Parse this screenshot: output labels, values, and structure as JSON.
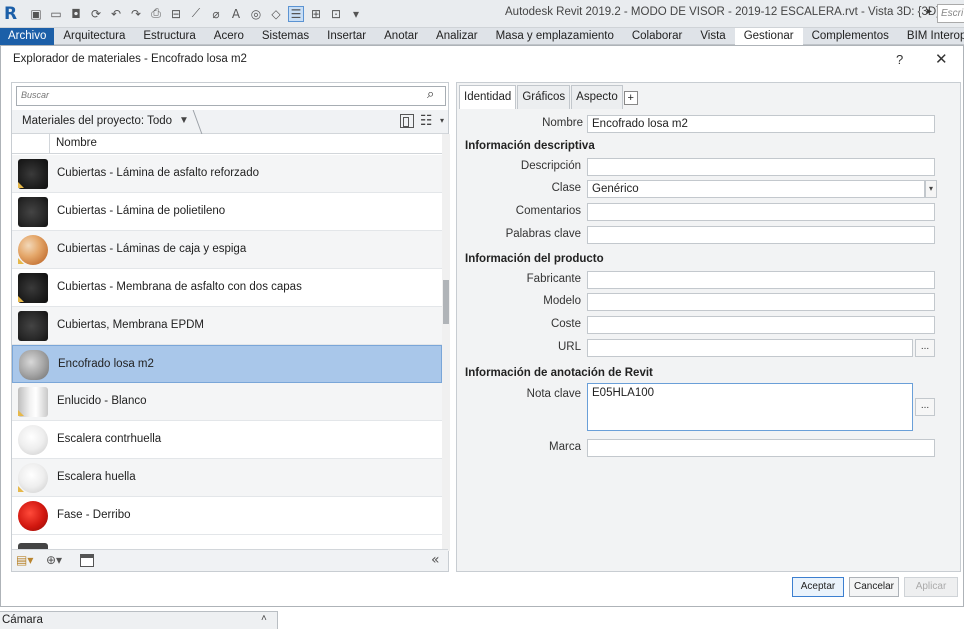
{
  "app_title": "Autodesk Revit 2019.2 - MODO DE VISOR - 2019-12 ESCALERA.rvt - Vista 3D: {3D}",
  "search_top_placeholder": "Escri",
  "ribbon_tabs": [
    "Archivo",
    "Arquitectura",
    "Estructura",
    "Acero",
    "Sistemas",
    "Insertar",
    "Anotar",
    "Analizar",
    "Masa y emplazamiento",
    "Colaborar",
    "Vista",
    "Gestionar",
    "Complementos",
    "BIM Interoperability"
  ],
  "ribbon_current": "Gestionar",
  "dialog": {
    "title": "Explorador de materiales - Encofrado losa m2",
    "help": "?",
    "close": "✕"
  },
  "browser": {
    "search_placeholder": "Buscar",
    "filter_label": "Materiales del proyecto: Todo",
    "column_header": "Nombre",
    "materials": [
      {
        "name": "Cubiertas - Lámina de asfalto reforzado",
        "swatch": "dark"
      },
      {
        "name": "Cubiertas - Lámina de polietileno",
        "swatch": "dark2"
      },
      {
        "name": "Cubiertas - Láminas de caja y espiga",
        "swatch": "wood"
      },
      {
        "name": "Cubiertas - Membrana de asfalto con dos capas",
        "swatch": "dark"
      },
      {
        "name": "Cubiertas, Membrana EPDM",
        "swatch": "dark2"
      },
      {
        "name": "Encofrado losa m2",
        "swatch": "concrete",
        "selected": true
      },
      {
        "name": "Enlucido - Blanco",
        "swatch": "white1"
      },
      {
        "name": "Escalera contrhuella",
        "swatch": "white2"
      },
      {
        "name": "Escalera huella",
        "swatch": "white2"
      },
      {
        "name": "Fase - Derribo",
        "swatch": "red"
      }
    ],
    "collapse_label": "«"
  },
  "tabs": [
    "Identidad",
    "Gráficos",
    "Aspecto"
  ],
  "tab_add": "+",
  "identity": {
    "nombre_label": "Nombre",
    "nombre_value": "Encofrado losa m2",
    "sec_descriptiva": "Información descriptiva",
    "descripcion_label": "Descripción",
    "descripcion_value": "",
    "clase_label": "Clase",
    "clase_value": "Genérico",
    "comentarios_label": "Comentarios",
    "comentarios_value": "",
    "palabras_label": "Palabras clave",
    "palabras_value": "",
    "sec_producto": "Información del producto",
    "fabricante_label": "Fabricante",
    "fabricante_value": "",
    "modelo_label": "Modelo",
    "modelo_value": "",
    "coste_label": "Coste",
    "coste_value": "",
    "url_label": "URL",
    "url_value": "",
    "sec_anotacion": "Información de anotación de Revit",
    "nota_label": "Nota clave",
    "nota_value": "E05HLA100",
    "marca_label": "Marca",
    "marca_value": "",
    "ellipsis": "..."
  },
  "buttons": {
    "accept": "Aceptar",
    "cancel": "Cancelar",
    "apply": "Aplicar"
  },
  "status": {
    "left": "Cámara",
    "arrow": "˄"
  },
  "colors": {
    "brand_blue": "#1c5fa8",
    "selection": "#a9c7ea"
  }
}
